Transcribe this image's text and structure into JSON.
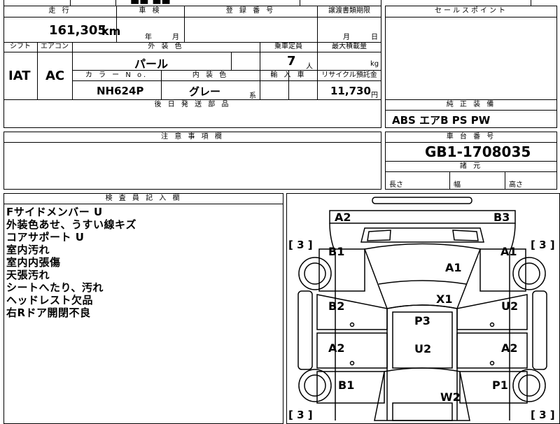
{
  "top_left": {
    "mileage_header": "走 行",
    "mileage_value": "161,305",
    "mileage_unit": "km",
    "inspection_header": "車 検",
    "inspection_year_label": "年",
    "inspection_month_label": "月",
    "registration_header": "登 録 番 号",
    "transfer_deadline_header": "譲渡書類期限",
    "transfer_month_label": "月",
    "transfer_day_label": "日",
    "shift_header": "シフト",
    "aircon_header": "エアコン",
    "exterior_color_header": "外 装 色",
    "capacity_header": "乗車定員",
    "max_load_header": "最大積載量",
    "shift_value": "IAT",
    "aircon_value": "AC",
    "exterior_color_value": "パール",
    "capacity_value": "7",
    "capacity_unit": "人",
    "max_load_unit": "kg",
    "color_no_header": "カ ラ ー N o.",
    "interior_color_header": "内 装 色",
    "import_header": "輸 入 車",
    "recycle_header": "リサイクル預託金",
    "color_no_value": "NH624P",
    "interior_color_value": "グレー",
    "interior_color_suffix": "系",
    "recycle_value": "11,730",
    "recycle_unit": "円",
    "later_parts_header": "後 日 発 送 部 品"
  },
  "sales_point": {
    "header": "セールスポイント"
  },
  "standard_equipment": {
    "header": "純 正 装 備",
    "value": "ABS エアB PS PW"
  },
  "notes": {
    "header": "注 意 事 項 欄"
  },
  "chassis": {
    "header": "車 台 番 号",
    "value": "GB1-1708035",
    "specs_header": "諸 元",
    "length_label": "長さ",
    "width_label": "幅",
    "height_label": "高さ"
  },
  "inspector": {
    "header": "検 査 員 記 入 欄",
    "lines": [
      "Fサイドメンバー U",
      "外装色あせ、うすい線キズ",
      "コアサポート U",
      "室内汚れ",
      "室内内張傷",
      "天張汚れ",
      "シートへたり、汚れ",
      "ヘッドレスト欠品",
      "右Rドア開閉不良"
    ]
  },
  "diagram": {
    "marks": {
      "front_left_corner": "A2",
      "front_right_corner": "B3",
      "bonnet": "A1",
      "left_front_fender": "B1",
      "right_front_fender": "A1",
      "roof": "X1",
      "left_front_door": "B2",
      "right_front_door": "U2",
      "roof_center": "P3",
      "left_rear_door": "A2",
      "right_rear_door": "A2",
      "rear_center": "U2",
      "left_rear_fender": "B1",
      "right_rear_fender": "P1",
      "back_door": "W2"
    },
    "tire_front_left": "[ 3 ]",
    "tire_front_right": "[ 3 ]",
    "tire_rear_left": "[ 3 ]",
    "tire_rear_right": "[ 3 ]"
  }
}
